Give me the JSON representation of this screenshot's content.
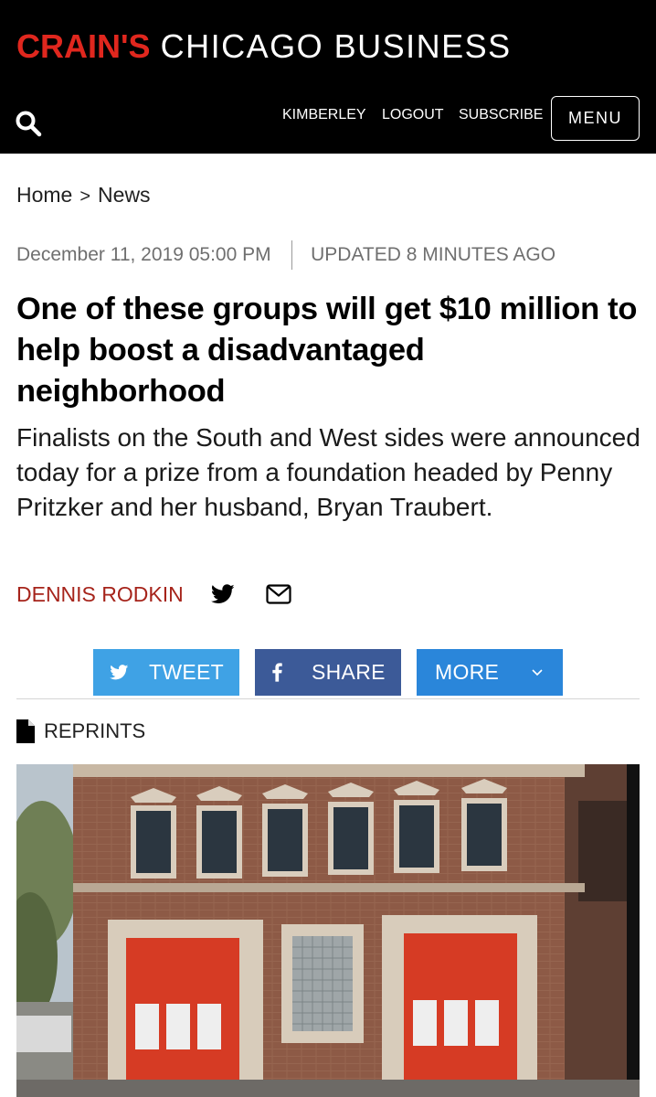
{
  "header": {
    "brand": "CRAIN'S",
    "title_rest": "CHICAGO BUSINESS",
    "search_icon": "search-icon",
    "nav": {
      "user": "KIMBERLEY",
      "logout": "LOGOUT",
      "subscribe": "SUBSCRIBE",
      "menu": "MENU"
    }
  },
  "breadcrumb": {
    "home": "Home",
    "separator": ">",
    "section": "News"
  },
  "article": {
    "date": "December 11, 2019 05:00 PM",
    "updated": "UPDATED 8 MINUTES AGO",
    "headline": "One of these groups will get $10 million to help boost a disadvantaged neighborhood",
    "subhead": "Finalists on the South and West sides were announced today for a prize from a foundation headed by Penny Pritzker and her husband, Bryan Traubert.",
    "author": "DENNIS RODKIN"
  },
  "share": {
    "tweet": "TWEET",
    "share": "SHARE",
    "more": "MORE"
  },
  "reprints": "REPRINTS",
  "colors": {
    "brand_red": "#e0271e",
    "author_red": "#a6241b",
    "tweet_blue": "#3fa2e5",
    "facebook_blue": "#3c5a98",
    "more_blue": "#2a86da"
  }
}
